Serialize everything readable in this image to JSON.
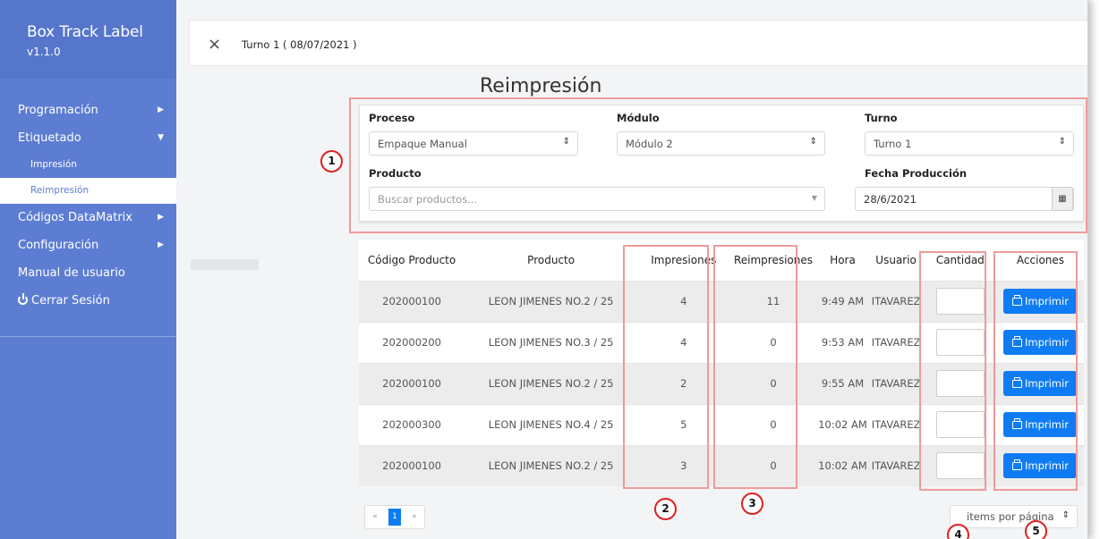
{
  "app": {
    "title": "Box Track Label",
    "version": "v1.1.0"
  },
  "sidebar": {
    "items": [
      {
        "label": "Programación"
      },
      {
        "label": "Etiquetado"
      },
      {
        "label": "Impresión"
      },
      {
        "label": "Reimpresión"
      },
      {
        "label": "Códigos DataMatrix"
      },
      {
        "label": "Configuración"
      },
      {
        "label": "Manual de usuario"
      },
      {
        "label": "Cerrar Sesión"
      }
    ]
  },
  "header": {
    "shift": "Turno 1 ( 08/07/2021 )",
    "close_icon": "×"
  },
  "page": {
    "title": "Reimpresión"
  },
  "filters": {
    "proceso": {
      "label": "Proceso",
      "value": "Empaque Manual"
    },
    "modulo": {
      "label": "Módulo",
      "value": "Módulo 2"
    },
    "turno": {
      "label": "Turno",
      "value": "Turno 1"
    },
    "producto": {
      "label": "Producto",
      "placeholder": "Buscar productos..."
    },
    "fecha": {
      "label": "Fecha Producción",
      "value": "28/6/2021"
    }
  },
  "table": {
    "headers": [
      "Código Producto",
      "Producto",
      "Impresiones",
      "Reimpresiones",
      "Hora",
      "Usuario",
      "Cantidad",
      "Acciones"
    ],
    "rows": [
      [
        "202000100",
        "LEON JIMENES NO.2 / 25",
        "4",
        "11",
        "9:49 AM",
        "ITAVAREZ"
      ],
      [
        "202000200",
        "LEON JIMENES NO.3 / 25",
        "4",
        "0",
        "9:53 AM",
        "ITAVAREZ"
      ],
      [
        "202000100",
        "LEON JIMENES NO.2 / 25",
        "2",
        "0",
        "9:55 AM",
        "ITAVAREZ"
      ],
      [
        "202000300",
        "LEON JIMENES NO.4 / 25",
        "5",
        "0",
        "10:02 AM",
        "ITAVAREZ"
      ],
      [
        "202000100",
        "LEON JIMENES NO.2 / 25",
        "3",
        "0",
        "10:02 AM",
        "ITAVAREZ"
      ]
    ],
    "action_label": "Imprimir"
  },
  "pagination": {
    "prev": "«",
    "current": "1",
    "next": "»",
    "per_page": "items por página"
  },
  "annotations": [
    "1",
    "2",
    "3",
    "4",
    "5"
  ],
  "colors": {
    "sidebar": "#5d7dd3",
    "primary": "#0f7cf3",
    "annotation_box": "#ef9a9a",
    "annotation_circle": "#e02020"
  }
}
